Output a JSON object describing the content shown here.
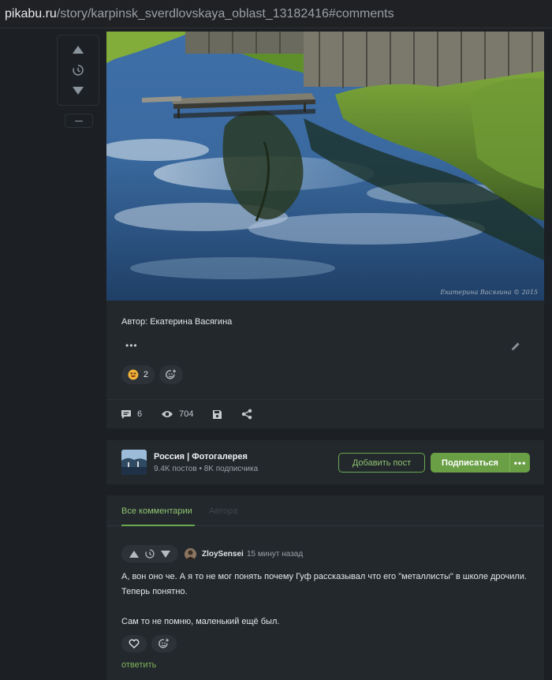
{
  "browser": {
    "url_host": "pikabu.ru",
    "url_path": "/story/karpinsk_sverdlovskaya_oblast_13182416#comments"
  },
  "post": {
    "watermark": "Екатерина Васягина © 2015",
    "author_line": "Автор: Екатерина Васягина",
    "more_label": "•••",
    "reaction_count": "2",
    "stats": {
      "comments": "6",
      "views": "704"
    }
  },
  "community": {
    "name": "Россия | Фотогалерея",
    "posts": "9.4K постов",
    "subscribers": "8K подписчика",
    "stats_separator": " • ",
    "add_post_label": "Добавить пост",
    "subscribe_label": "Подписаться",
    "menu_label": "•••"
  },
  "comments": {
    "tabs": [
      {
        "label": "Все комментарии"
      },
      {
        "label": "Автора"
      }
    ],
    "items": [
      {
        "user": "ZloySensei",
        "time": "15 минут назад",
        "text1": "А, вон оно че. А я то не мог понять почему Гуф рассказывал что его \"металлисты\" в школе дрочили. Теперь понятно.",
        "text2": "Сам то не помню, маленький ещё был.",
        "reply_label": "ответить"
      }
    ]
  },
  "colors": {
    "accent": "#6a9f45",
    "accent_text": "#8fc36f",
    "page_bg": "#1c2024",
    "card_bg": "#23282d"
  }
}
